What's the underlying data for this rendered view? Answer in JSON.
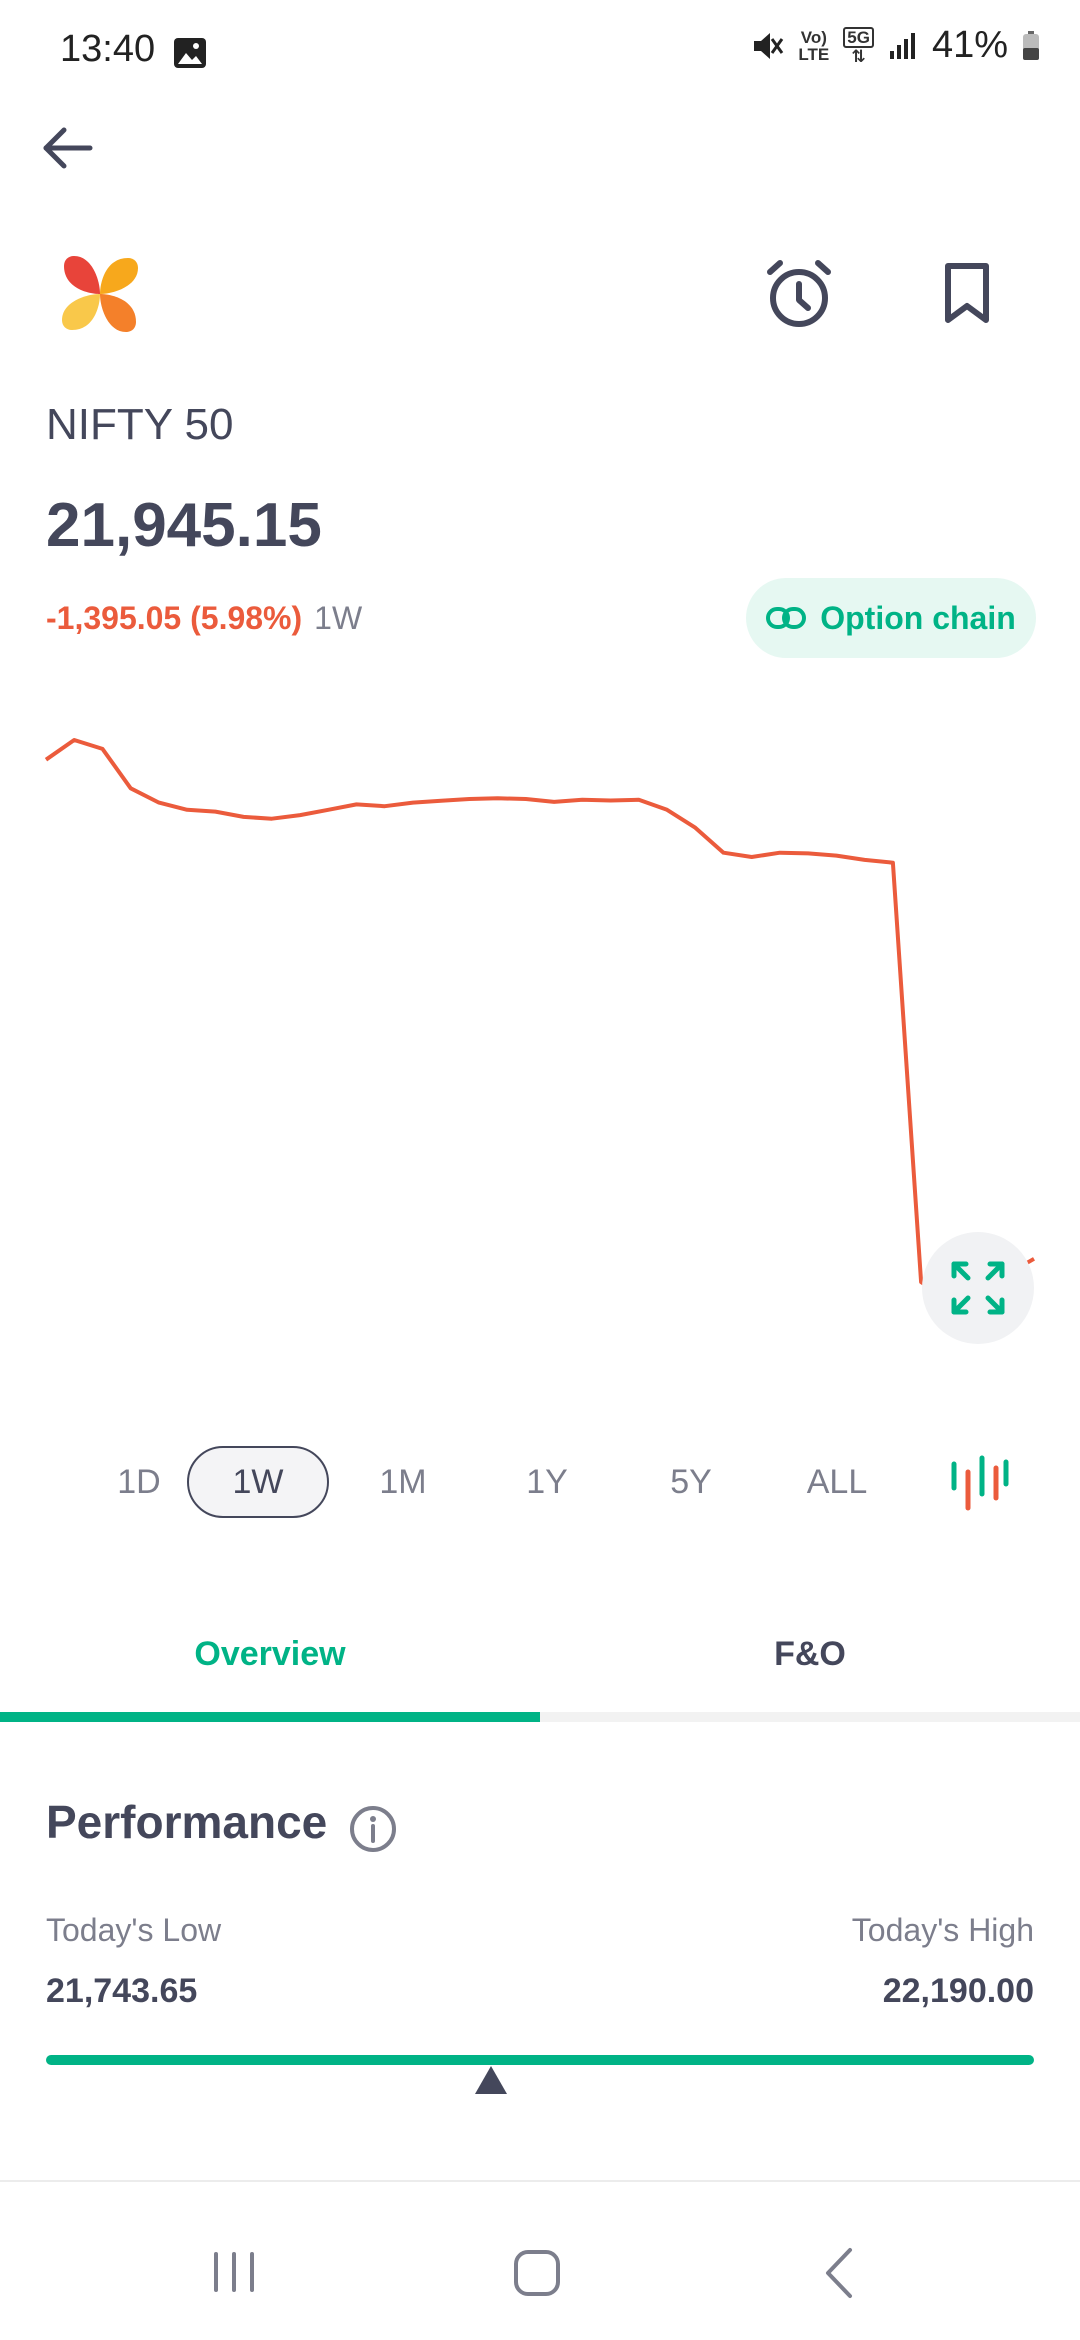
{
  "status_bar": {
    "time": "13:40",
    "network_top": "Vo)",
    "network_bottom": "LTE",
    "network_5g": "5G",
    "battery": "41%"
  },
  "header": {
    "back_icon": "arrow-left-icon",
    "logo_icon": "four-petal-logo-icon",
    "alarm_icon": "alarm-clock-icon",
    "bookmark_icon": "bookmark-icon"
  },
  "instrument": {
    "name": "NIFTY 50",
    "price": "21,945.15",
    "change": "-1,395.05 (5.98%)",
    "period": "1W",
    "option_chain_label": "Option chain"
  },
  "colors": {
    "accent": "#00b386",
    "negative": "#eb5b3c",
    "text": "#44475b",
    "muted": "#7c7e8c"
  },
  "chart_data": {
    "type": "line",
    "range": "1W",
    "series": [
      {
        "color": "#eb5b3c",
        "values": [
          23340,
          23395,
          23370,
          23260,
          23220,
          23200,
          23195,
          23180,
          23175,
          23185,
          23200,
          23215,
          23210,
          23220,
          23225,
          23230,
          23232,
          23230,
          23222,
          23228,
          23226,
          23228,
          23200,
          23150,
          23080,
          23068,
          23080,
          23078,
          23072,
          23060,
          23052,
          21880,
          21830,
          21860,
          21900,
          21945.15
        ]
      }
    ],
    "grid": false,
    "expand_icon": "expand-arrows-icon"
  },
  "timeframes": {
    "items": [
      "1D",
      "1W",
      "1M",
      "1Y",
      "5Y",
      "ALL"
    ],
    "selected": "1W",
    "candle_icon": "candlestick-icon"
  },
  "tabs": {
    "overview": "Overview",
    "fo": "F&O",
    "active": "Overview"
  },
  "performance": {
    "title": "Performance",
    "info_icon": "info-icon",
    "low_label": "Today's Low",
    "low_value": "21,743.65",
    "high_label": "Today's High",
    "high_value": "22,190.00",
    "current_position_fraction": 0.45
  },
  "nav_bar": {
    "recents_icon": "recents-icon",
    "home_icon": "home-icon",
    "back_icon": "nav-back-icon"
  }
}
